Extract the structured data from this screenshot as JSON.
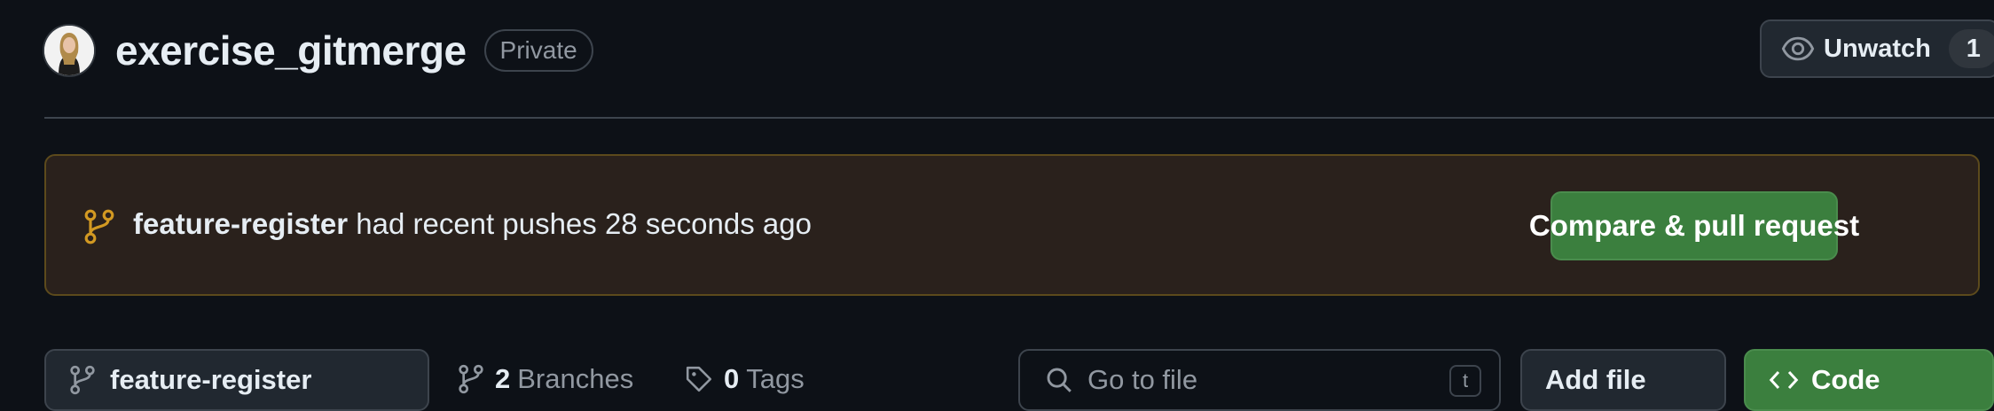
{
  "repo": {
    "name": "exercise_gitmerge",
    "visibility": "Private"
  },
  "watch": {
    "label": "Unwatch",
    "count": "1"
  },
  "banner": {
    "branch": "feature-register",
    "message": " had recent pushes 28 seconds ago",
    "action_label": "Compare & pull request"
  },
  "toolbar": {
    "branch_label": "feature-register",
    "branches_count": "2",
    "branches_word": "Branches",
    "tags_count": "0",
    "tags_word": "Tags",
    "goto_placeholder": "Go to file",
    "goto_shortcut": "t",
    "add_file_label": "Add file",
    "code_label": "Code"
  },
  "colors": {
    "background": "#0d1117",
    "accent_green": "#3b7f3e",
    "banner_bg": "#2a211c",
    "branch_icon": "#d29922"
  },
  "icons": {
    "avatar": "avatar",
    "watch": "eye-icon",
    "branch": "git-branch-icon",
    "tag": "tag-icon",
    "search": "search-icon",
    "code": "code-icon"
  }
}
